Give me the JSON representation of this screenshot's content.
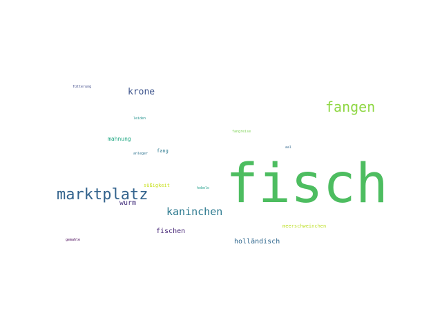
{
  "words": [
    {
      "text": "fisch",
      "color": "#4dbd60"
    },
    {
      "text": "marktplatz",
      "color": "#33638d"
    },
    {
      "text": "fangen",
      "color": "#8fd744"
    },
    {
      "text": "kaninchen",
      "color": "#2a788e"
    },
    {
      "text": "krone",
      "color": "#3b528b"
    },
    {
      "text": "holländisch",
      "color": "#31688e"
    },
    {
      "text": "fischen",
      "color": "#482878"
    },
    {
      "text": "wurm",
      "color": "#46327e"
    },
    {
      "text": "mahnung",
      "color": "#22a884"
    },
    {
      "text": "fang",
      "color": "#2a788e"
    },
    {
      "text": "meerschweinchen",
      "color": "#bddf26"
    },
    {
      "text": "süßigkeit",
      "color": "#c8e020"
    },
    {
      "text": "fütterung",
      "color": "#3e4989"
    },
    {
      "text": "leiden",
      "color": "#21918c"
    },
    {
      "text": "fangreise",
      "color": "#7ad151"
    },
    {
      "text": "aal",
      "color": "#31688e"
    },
    {
      "text": "anleger",
      "color": "#2c728e"
    },
    {
      "text": "hobelo",
      "color": "#1f9e89"
    },
    {
      "text": "gemahle",
      "color": "#440154"
    }
  ]
}
